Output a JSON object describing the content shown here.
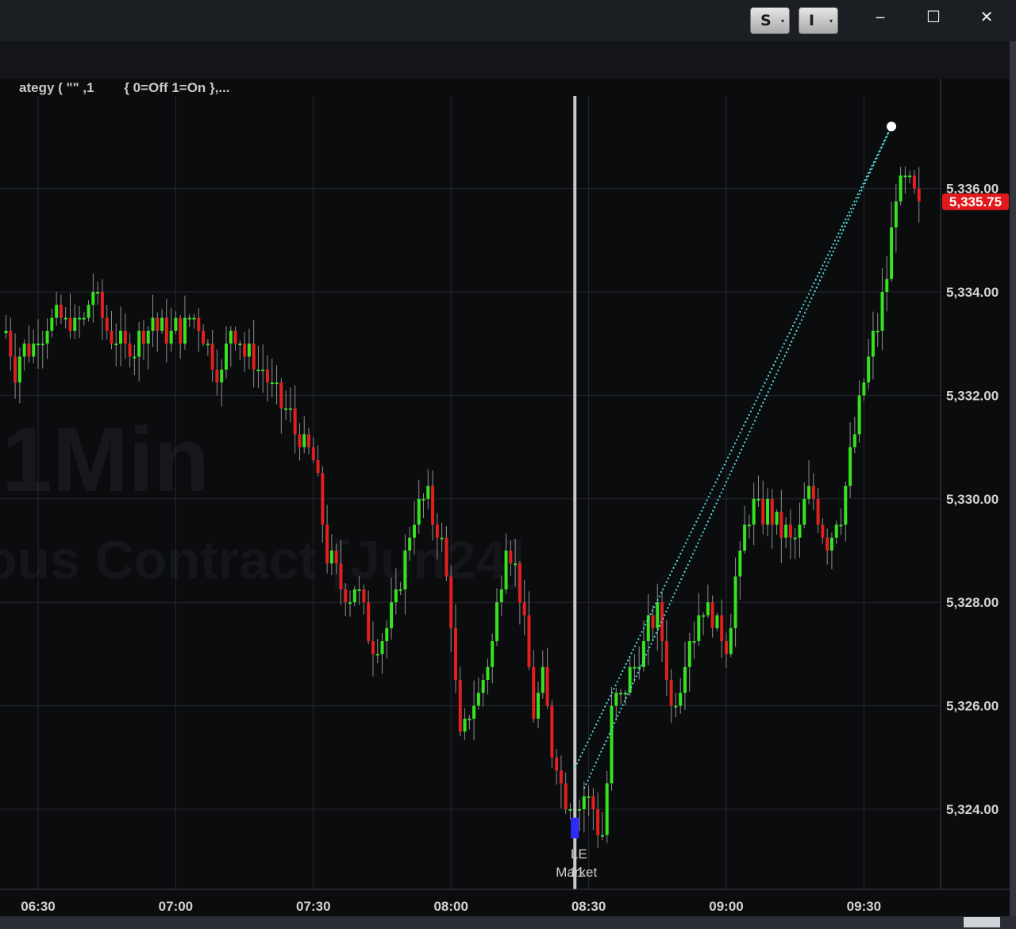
{
  "window": {
    "buttons": [
      {
        "label": "S",
        "caret": "▾"
      },
      {
        "label": "I",
        "caret": "▾"
      }
    ],
    "minimize_label": "‒",
    "maximize_label": "☐",
    "close_label": "✕"
  },
  "status_text": "ategy ( \"\" ,1        { 0=Off 1=On },...",
  "watermark": {
    "line1": ",1Min",
    "line2": "ous Contract [Jun24]"
  },
  "chart_data": {
    "type": "candlestick",
    "interval": "1 Min",
    "ylim": [
      5322.0,
      5337.0
    ],
    "y_ticks": [
      5324,
      5326,
      5328,
      5330,
      5332,
      5334,
      5336
    ],
    "y_tick_labels": [
      "5,324.00",
      "5,326.00",
      "5,328.00",
      "5,330.00",
      "5,332.00",
      "5,334.00",
      "5,336.00"
    ],
    "x_ticks": [
      "06:30",
      "07:00",
      "07:30",
      "08:00",
      "08:30",
      "09:00",
      "09:30"
    ],
    "last_price_label": "5,335.75",
    "colors": {
      "up": "#36e31f",
      "down": "#e21f1f",
      "grid": "#24272c",
      "trendline": "#56d8e0",
      "cursor": "#c8c8c8",
      "price_tag": "#e0191c",
      "marker": "#2c2cff"
    },
    "time_window": [
      "06:23",
      "09:42"
    ],
    "price_path": [
      [
        "06:23",
        5333.2
      ],
      [
        "06:25",
        5332.6
      ],
      [
        "06:30",
        5333.2
      ],
      [
        "06:35",
        5333.5
      ],
      [
        "06:40",
        5333.3
      ],
      [
        "06:42",
        5334.1
      ],
      [
        "06:45",
        5333.2
      ],
      [
        "06:50",
        5332.9
      ],
      [
        "06:55",
        5333.4
      ],
      [
        "07:00",
        5333.2
      ],
      [
        "07:05",
        5333.5
      ],
      [
        "07:08",
        5332.7
      ],
      [
        "07:10",
        5332.4
      ],
      [
        "07:12",
        5333.4
      ],
      [
        "07:15",
        5332.9
      ],
      [
        "07:20",
        5332.3
      ],
      [
        "07:25",
        5331.5
      ],
      [
        "07:30",
        5330.7
      ],
      [
        "07:33",
        5329.0
      ],
      [
        "07:36",
        5328.3
      ],
      [
        "07:40",
        5328.2
      ],
      [
        "07:43",
        5327.1
      ],
      [
        "07:46",
        5327.6
      ],
      [
        "07:48",
        5328.0
      ],
      [
        "07:52",
        5329.7
      ],
      [
        "07:55",
        5330.0
      ],
      [
        "07:58",
        5329.0
      ],
      [
        "08:00",
        5327.7
      ],
      [
        "08:02",
        5325.2
      ],
      [
        "08:04",
        5325.8
      ],
      [
        "08:07",
        5326.4
      ],
      [
        "08:09",
        5327.3
      ],
      [
        "08:12",
        5329.2
      ],
      [
        "08:14",
        5328.7
      ],
      [
        "08:16",
        5327.5
      ],
      [
        "08:18",
        5325.9
      ],
      [
        "08:20",
        5326.4
      ],
      [
        "08:22",
        5325.2
      ],
      [
        "08:25",
        5324.3
      ],
      [
        "08:28",
        5324.1
      ],
      [
        "08:30",
        5324.2
      ],
      [
        "08:33",
        5323.4
      ],
      [
        "08:35",
        5325.8
      ],
      [
        "08:40",
        5326.8
      ],
      [
        "08:45",
        5327.9
      ],
      [
        "08:48",
        5325.9
      ],
      [
        "08:52",
        5327.3
      ],
      [
        "08:55",
        5327.9
      ],
      [
        "09:00",
        5327.3
      ],
      [
        "09:04",
        5329.4
      ],
      [
        "09:06",
        5329.9
      ],
      [
        "09:10",
        5329.7
      ],
      [
        "09:15",
        5329.1
      ],
      [
        "09:18",
        5330.2
      ],
      [
        "09:22",
        5329.2
      ],
      [
        "09:25",
        5329.8
      ],
      [
        "09:28",
        5331.3
      ],
      [
        "09:32",
        5333.0
      ],
      [
        "09:35",
        5334.3
      ],
      [
        "09:37",
        5335.9
      ],
      [
        "09:39",
        5336.1
      ],
      [
        "09:41",
        5335.75
      ]
    ],
    "cursor_time": "08:27",
    "trendlines": [
      {
        "start": [
          "08:27",
          5324.8
        ],
        "end": [
          "09:36",
          5337.2
        ]
      },
      {
        "start": [
          "08:29",
          5324.4
        ],
        "end": [
          "09:36",
          5337.2
        ]
      }
    ],
    "trade_marker": {
      "time": "08:27",
      "price": 5323.5,
      "labels": [
        "LE",
        "Market",
        "1",
        "1"
      ]
    }
  }
}
